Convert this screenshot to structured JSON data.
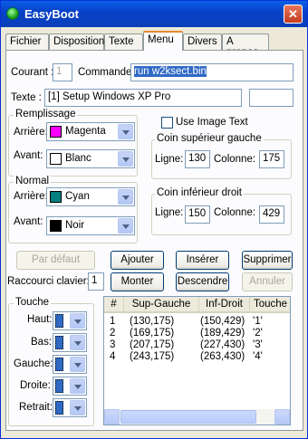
{
  "window": {
    "title": "EasyBoot",
    "close": "✕"
  },
  "tabs": [
    "Fichier",
    "Disposition",
    "Texte",
    "Menu",
    "Divers",
    "A propos"
  ],
  "menu": {
    "courant_label": "Courant :",
    "courant_value": "1",
    "commande_label": "Commande :",
    "commande_value": "run w2ksect.bin",
    "texte_label": "Texte :",
    "texte_value": "[1] Setup Windows XP Pro",
    "texte_extra": "",
    "remplissage": {
      "title": "Remplissage",
      "arriere_label": "Arrière:",
      "arriere_value": "Magenta",
      "arriere_color": "#ff00ff",
      "avant_label": "Avant:",
      "avant_value": "Blanc",
      "avant_color": "#ffffff"
    },
    "normal": {
      "title": "Normal",
      "arriere_label": "Arrière:",
      "arriere_value": "Cyan",
      "arriere_color": "#008080",
      "avant_label": "Avant:",
      "avant_value": "Noir",
      "avant_color": "#000000"
    },
    "use_image_text": "Use Image Text",
    "coin_sup": {
      "title": "Coin supérieur gauche",
      "ligne_label": "Ligne:",
      "ligne_value": "130",
      "colonne_label": "Colonne:",
      "colonne_value": "175"
    },
    "coin_inf": {
      "title": "Coin inférieur droit",
      "ligne_label": "Ligne:",
      "ligne_value": "150",
      "colonne_label": "Colonne:",
      "colonne_value": "429"
    },
    "buttons": {
      "par_defaut": "Par défaut",
      "ajouter": "Ajouter",
      "inserer": "Insérer",
      "supprimer": "Supprimer",
      "monter": "Monter",
      "descendre": "Descendre",
      "annuler": "Annuler"
    },
    "raccourci_label": "Raccourci clavier:",
    "raccourci_value": "1",
    "touche": {
      "title": "Touche",
      "haut": "Haut:",
      "bas": "Bas:",
      "gauche": "Gauche:",
      "droite": "Droite:",
      "retrait": "Retrait:"
    },
    "list": {
      "headers": [
        "#",
        "Sup-Gauche",
        "Inf-Droit",
        "Touche"
      ],
      "rows": [
        [
          "1",
          "(130,175)",
          "(150,429)",
          "'1'"
        ],
        [
          "2",
          "(169,175)",
          "(189,429)",
          "'2'"
        ],
        [
          "3",
          "(207,175)",
          "(227,430)",
          "'3'"
        ],
        [
          "4",
          "(243,175)",
          "(263,430)",
          "'4'"
        ]
      ]
    }
  }
}
